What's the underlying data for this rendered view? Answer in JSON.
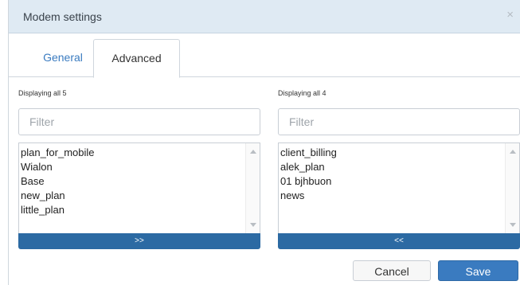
{
  "dialog": {
    "title": "Modem settings",
    "close_glyph": "×"
  },
  "tabs": [
    {
      "label": "General",
      "active": false
    },
    {
      "label": "Advanced",
      "active": true
    }
  ],
  "left_list": {
    "count_text": "Displaying all 5",
    "filter_placeholder": "Filter",
    "filter_value": "",
    "items": [
      "plan_for_mobile",
      "Wialon",
      "Base",
      "new_plan",
      "little_plan"
    ],
    "move_button_label": ">>"
  },
  "right_list": {
    "count_text": "Displaying all 4",
    "filter_placeholder": "Filter",
    "filter_value": "",
    "items": [
      "client_billing",
      "alek_plan",
      "01 bjhbuon",
      "news"
    ],
    "move_button_label": "<<"
  },
  "footer": {
    "cancel_label": "Cancel",
    "save_label": "Save"
  },
  "colors": {
    "titlebar": "#dfeaf3",
    "primary": "#3a7bc0",
    "move_button": "#2c6aa3"
  }
}
